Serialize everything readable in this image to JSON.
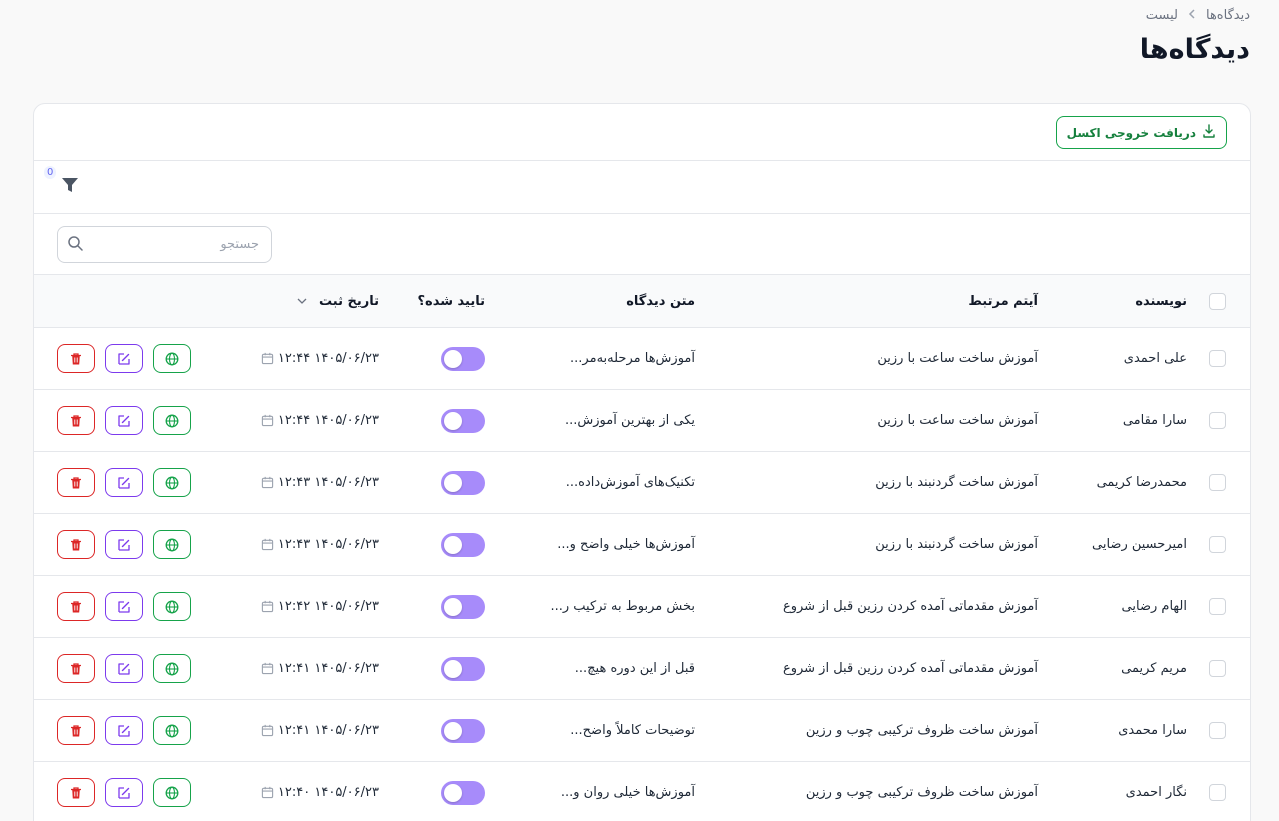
{
  "breadcrumb": {
    "parent": "دیدگاه‌ها",
    "current": "لیست"
  },
  "page_title": "دیدگاه‌ها",
  "toolbar": {
    "export_label": "دریافت خروجی اکسل"
  },
  "filter": {
    "count": "0"
  },
  "search": {
    "placeholder": "جستجو",
    "value": ""
  },
  "columns": {
    "author": "نویسنده",
    "item": "آیتم مرتبط",
    "text": "متن دیدگاه",
    "approved": "تایید شده؟",
    "date": "تاریخ ثبت"
  },
  "colors": {
    "accent": "#a78bfa",
    "delete": "#dc2626",
    "edit": "#7c3aed",
    "view": "#16a34a",
    "export": "#15803d"
  },
  "rows": [
    {
      "author": "علی احمدی",
      "item": "آموزش ساخت ساعت با رزین",
      "text": "آموزش‌ها مرحله‌به‌مر...",
      "date": "۱۴۰۵/۰۶/۲۳ ۱۲:۴۴",
      "approved": false
    },
    {
      "author": "سارا مقامی",
      "item": "آموزش ساخت ساعت با رزین",
      "text": "یکی از بهترین آموزش...",
      "date": "۱۴۰۵/۰۶/۲۳ ۱۲:۴۴",
      "approved": false
    },
    {
      "author": "محمدرضا کریمی",
      "item": "آموزش ساخت گردنبند با رزین",
      "text": "تکنیک‌های آموزش‌داده...",
      "date": "۱۴۰۵/۰۶/۲۳ ۱۲:۴۳",
      "approved": false
    },
    {
      "author": "امیرحسین رضایی",
      "item": "آموزش ساخت گردنبند با رزین",
      "text": "آموزش‌ها خیلی واضح و...",
      "date": "۱۴۰۵/۰۶/۲۳ ۱۲:۴۳",
      "approved": false
    },
    {
      "author": "الهام رضایی",
      "item": "آموزش مقدماتی آمده کردن رزین قبل از شروع",
      "text": "بخش مربوط به ترکیب ر...",
      "date": "۱۴۰۵/۰۶/۲۳ ۱۲:۴۲",
      "approved": false
    },
    {
      "author": "مریم کریمی",
      "item": "آموزش مقدماتی آمده کردن رزین قبل از شروع",
      "text": "قبل از این دوره هیچ...",
      "date": "۱۴۰۵/۰۶/۲۳ ۱۲:۴۱",
      "approved": false
    },
    {
      "author": "سارا محمدی",
      "item": "آموزش ساخت ظروف ترکیبی چوب و رزین",
      "text": "توضیحات کاملاً واضح...",
      "date": "۱۴۰۵/۰۶/۲۳ ۱۲:۴۱",
      "approved": false
    },
    {
      "author": "نگار احمدی",
      "item": "آموزش ساخت ظروف ترکیبی چوب و رزین",
      "text": "آموزش‌ها خیلی روان و...",
      "date": "۱۴۰۵/۰۶/۲۳ ۱۲:۴۰",
      "approved": false
    }
  ]
}
